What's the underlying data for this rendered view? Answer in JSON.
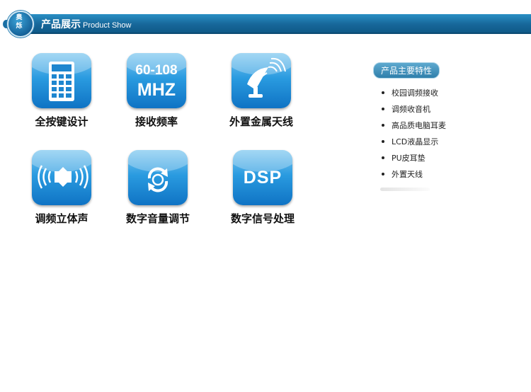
{
  "header": {
    "logo_text": [
      "奥",
      "烁"
    ],
    "title_cn": "产品展示",
    "title_en": "Product Show",
    "bar_color": "#17679a"
  },
  "features": [
    {
      "label": "全按键设计",
      "icon": "calculator-keypad-icon"
    },
    {
      "label": "接收频率",
      "icon": "frequency-range-icon",
      "line1": "60-108",
      "line2": "MHZ"
    },
    {
      "label": "外置金属天线",
      "icon": "satellite-antenna-icon"
    },
    {
      "label": "调频立体声",
      "icon": "stereo-speaker-icon"
    },
    {
      "label": "数字音量调节",
      "icon": "volume-rotate-icon"
    },
    {
      "label": "数字信号处理",
      "icon": "dsp-chip-icon",
      "tile_text": "DSP"
    }
  ],
  "specs": {
    "title": "产品主要特性",
    "items": [
      "校园调频接收",
      "调频收音机",
      "高品质电脑耳麦",
      "LCD液晶显示",
      "PU皮耳垫",
      "外置天线"
    ]
  },
  "colors": {
    "accent": "#2a9be0",
    "tile_dark": "#0f73c4",
    "pill": "#2f7fab"
  }
}
